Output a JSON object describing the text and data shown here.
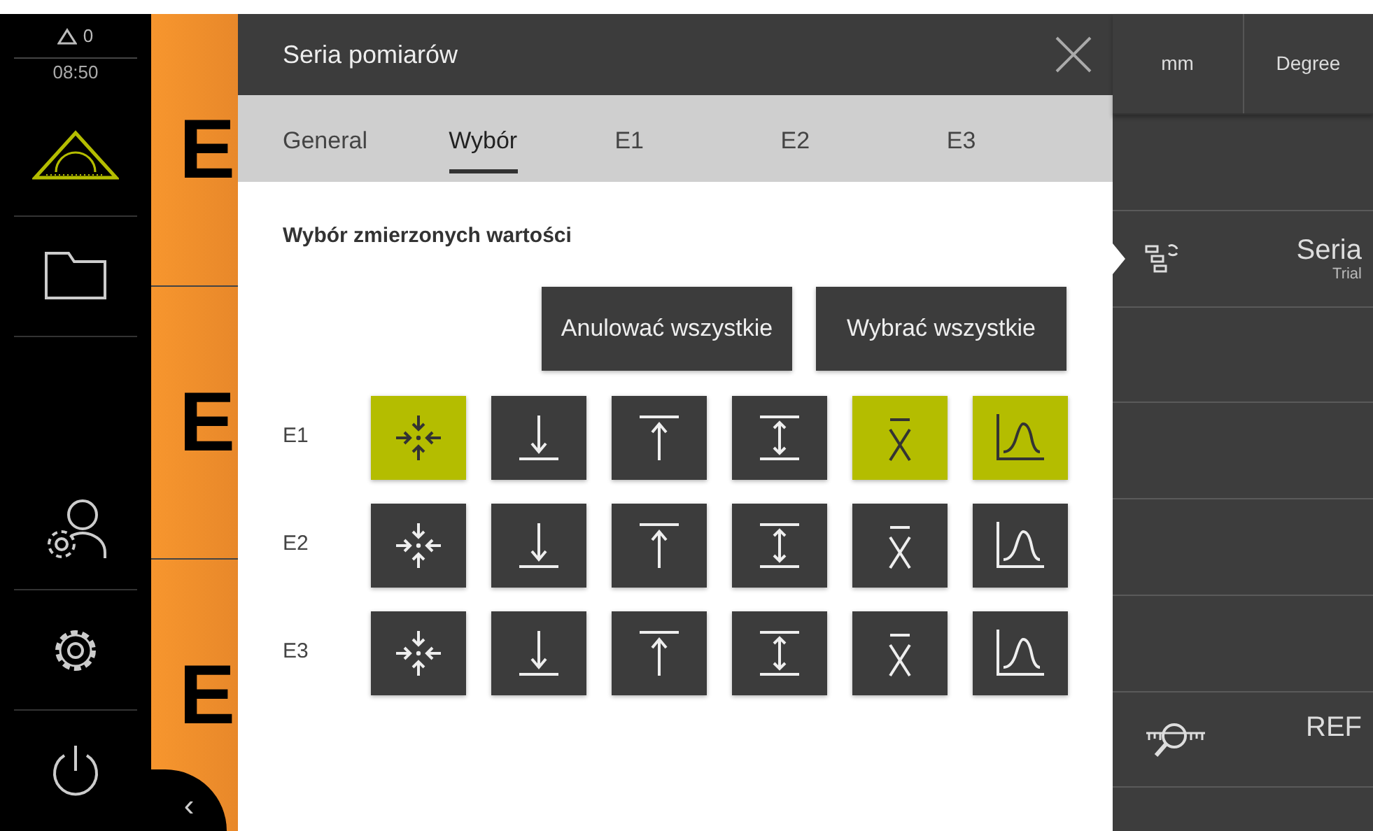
{
  "sidebar": {
    "warning_count": "0",
    "time": "08:50",
    "items": [
      {
        "kind": "measure"
      },
      {
        "kind": "folder"
      },
      {
        "kind": "spacer"
      },
      {
        "kind": "user"
      },
      {
        "kind": "settings"
      },
      {
        "kind": "power"
      }
    ]
  },
  "feature_column": {
    "letters": [
      "E",
      "E",
      "E"
    ],
    "collapse": "‹"
  },
  "dialog": {
    "title": "Seria pomiarów",
    "tabs": [
      {
        "label": "General",
        "selected": false
      },
      {
        "label": "Wybór",
        "selected": true
      },
      {
        "label": "E1",
        "selected": false
      },
      {
        "label": "E2",
        "selected": false
      },
      {
        "label": "E3",
        "selected": false
      }
    ],
    "heading": "Wybór zmierzonych wartości",
    "buttons": [
      "Anulować wszystkie",
      "Wybrać wszystkie"
    ],
    "rows": [
      {
        "label": "E1",
        "tiles": [
          {
            "kind": "center",
            "selected": true
          },
          {
            "kind": "min",
            "selected": false
          },
          {
            "kind": "max",
            "selected": false
          },
          {
            "kind": "range",
            "selected": false
          },
          {
            "kind": "mean",
            "selected": true
          },
          {
            "kind": "distribution",
            "selected": true
          }
        ]
      },
      {
        "label": "E2",
        "tiles": [
          {
            "kind": "center",
            "selected": false
          },
          {
            "kind": "min",
            "selected": false
          },
          {
            "kind": "max",
            "selected": false
          },
          {
            "kind": "range",
            "selected": false
          },
          {
            "kind": "mean",
            "selected": false
          },
          {
            "kind": "distribution",
            "selected": false
          }
        ]
      },
      {
        "label": "E3",
        "tiles": [
          {
            "kind": "center",
            "selected": false
          },
          {
            "kind": "min",
            "selected": false
          },
          {
            "kind": "max",
            "selected": false
          },
          {
            "kind": "range",
            "selected": false
          },
          {
            "kind": "mean",
            "selected": false
          },
          {
            "kind": "distribution",
            "selected": false
          }
        ]
      }
    ]
  },
  "right_panel": {
    "units": [
      "mm",
      "Degree"
    ],
    "rows": [
      {
        "kind": "empty"
      },
      {
        "kind": "series",
        "title": "Seria",
        "subtitle": "Trial"
      },
      {
        "kind": "empty"
      },
      {
        "kind": "empty"
      },
      {
        "kind": "empty"
      },
      {
        "kind": "empty"
      },
      {
        "kind": "ref",
        "title": "REF"
      },
      {
        "kind": "empty"
      }
    ]
  }
}
